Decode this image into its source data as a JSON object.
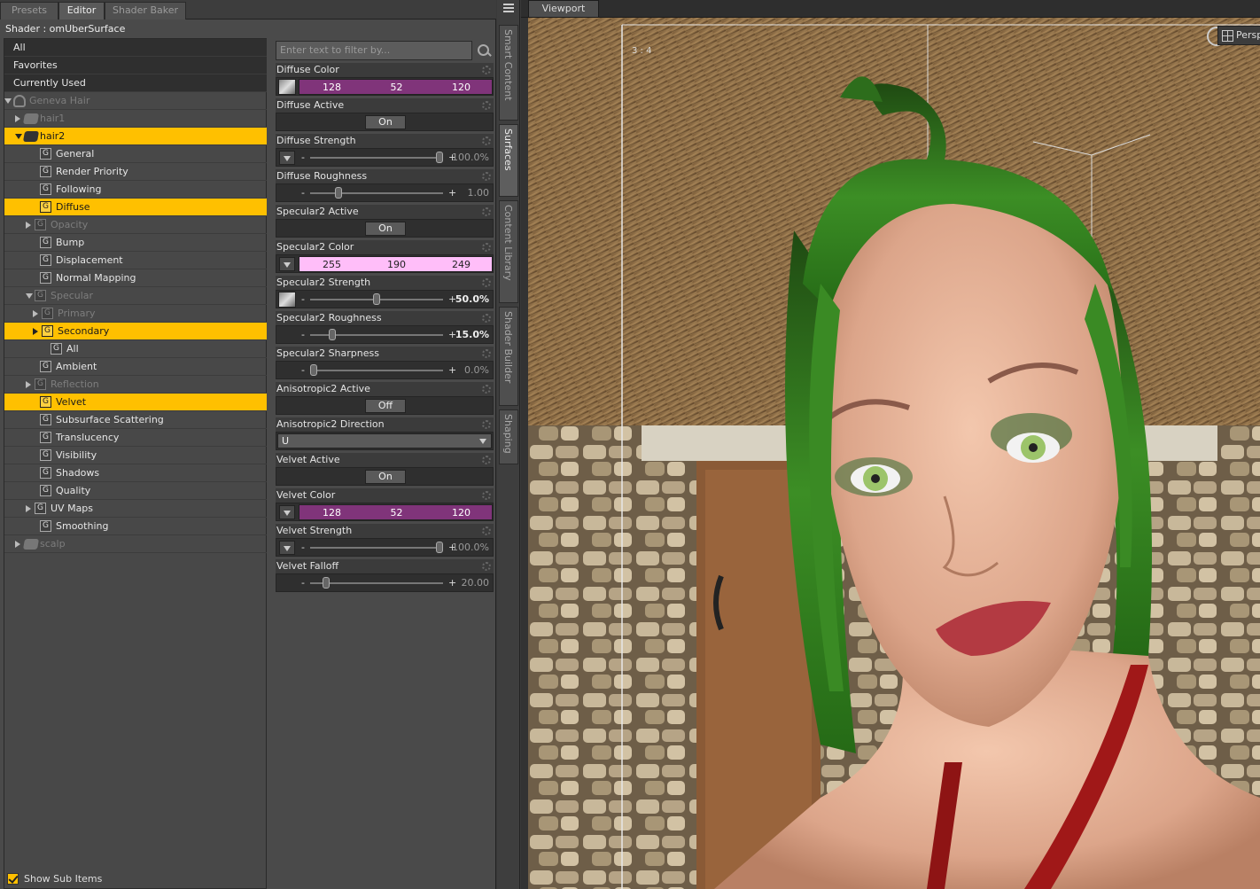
{
  "tabs": [
    "Presets",
    "Editor",
    "Shader Baker"
  ],
  "active_tab": "Editor",
  "shader_label": "Shader : omUberSurface",
  "tree": [
    {
      "label": "All",
      "kind": "cat"
    },
    {
      "label": "Favorites",
      "kind": "cat"
    },
    {
      "label": "Currently Used",
      "kind": "cat"
    },
    {
      "label": "Geneva Hair",
      "icon": "figure-icon",
      "expand": "down",
      "dim": true
    },
    {
      "label": "hair1",
      "icon": "object-icon",
      "expand": "right",
      "dim": true
    },
    {
      "label": "hair2",
      "icon": "object-icon",
      "expand": "down",
      "selected": true
    },
    {
      "label": "General",
      "icon": "group-icon"
    },
    {
      "label": "Render Priority",
      "icon": "group-icon"
    },
    {
      "label": "Following",
      "icon": "group-icon"
    },
    {
      "label": "Diffuse",
      "icon": "group-icon",
      "selected": true
    },
    {
      "label": "Opacity",
      "icon": "group-icon",
      "expand": "right",
      "dim": true
    },
    {
      "label": "Bump",
      "icon": "group-icon"
    },
    {
      "label": "Displacement",
      "icon": "group-icon"
    },
    {
      "label": "Normal Mapping",
      "icon": "group-icon"
    },
    {
      "label": "Specular",
      "icon": "group-icon",
      "expand": "down",
      "dim": true
    },
    {
      "label": "Primary",
      "icon": "group-icon",
      "expand": "right",
      "dim": true
    },
    {
      "label": "Secondary",
      "icon": "group-icon",
      "expand": "right",
      "selected": true
    },
    {
      "label": "All",
      "icon": "group-icon"
    },
    {
      "label": "Ambient",
      "icon": "group-icon"
    },
    {
      "label": "Reflection",
      "icon": "group-icon",
      "expand": "right",
      "dim": true
    },
    {
      "label": "Velvet",
      "icon": "group-icon",
      "selected": true
    },
    {
      "label": "Subsurface Scattering",
      "icon": "group-icon"
    },
    {
      "label": "Translucency",
      "icon": "group-icon"
    },
    {
      "label": "Visibility",
      "icon": "group-icon"
    },
    {
      "label": "Shadows",
      "icon": "group-icon"
    },
    {
      "label": "Quality",
      "icon": "group-icon"
    },
    {
      "label": "UV Maps",
      "icon": "group-icon",
      "expand": "right"
    },
    {
      "label": "Smoothing",
      "icon": "group-icon"
    },
    {
      "label": "scalp",
      "icon": "object-icon",
      "expand": "right",
      "dim": true
    }
  ],
  "group_glyph": "G",
  "show_sub_items": {
    "label": "Show Sub Items",
    "checked": true
  },
  "filter_placeholder": "Enter text to filter by...",
  "properties": [
    {
      "name": "Diffuse Color",
      "type": "color",
      "thumb": true,
      "rgb": [
        128,
        52,
        120
      ],
      "bg": "#80347a",
      "fg": "#ffffff"
    },
    {
      "name": "Diffuse Active",
      "type": "toggle",
      "value": "On"
    },
    {
      "name": "Diffuse Strength",
      "type": "slider",
      "menu": true,
      "fraction": 1.0,
      "value": "100.0%",
      "bold": false
    },
    {
      "name": "Diffuse Roughness",
      "type": "slider",
      "fraction": 0.2,
      "value": "1.00",
      "bold": false
    },
    {
      "name": "Specular2 Active",
      "type": "toggle",
      "value": "On"
    },
    {
      "name": "Specular2 Color",
      "type": "color",
      "thumb": false,
      "rgb": [
        255,
        190,
        249
      ],
      "bg": "#ffbef9",
      "fg": "#222222"
    },
    {
      "name": "Specular2 Strength",
      "type": "slider",
      "thumb": true,
      "fraction": 0.5,
      "value": "50.0%",
      "bold": true
    },
    {
      "name": "Specular2 Roughness",
      "type": "slider",
      "fraction": 0.15,
      "value": "15.0%",
      "bold": true
    },
    {
      "name": "Specular2 Sharpness",
      "type": "slider",
      "fraction": 0.0,
      "value": "0.0%",
      "bold": false
    },
    {
      "name": "Anisotropic2 Active",
      "type": "toggle",
      "value": "Off"
    },
    {
      "name": "Anisotropic2 Direction",
      "type": "dropdown",
      "value": "U"
    },
    {
      "name": "Velvet Active",
      "type": "toggle",
      "value": "On"
    },
    {
      "name": "Velvet Color",
      "type": "color",
      "thumb": false,
      "rgb": [
        128,
        52,
        120
      ],
      "bg": "#80347a",
      "fg": "#ffffff"
    },
    {
      "name": "Velvet Strength",
      "type": "slider",
      "menu": true,
      "fraction": 1.0,
      "value": "100.0%",
      "bold": false
    },
    {
      "name": "Velvet Falloff",
      "type": "slider",
      "fraction": 0.1,
      "value": "20.00",
      "bold": false
    }
  ],
  "side_tabs": [
    "Smart Content",
    "Surfaces",
    "Content Library",
    "Shader Builder",
    "Shaping"
  ],
  "active_side_tab": "Surfaces",
  "viewport": {
    "tab": "Viewport",
    "aspect": "3 : 4",
    "camera": "Persp"
  },
  "colors": {
    "selection": "#ffc000",
    "panel": "#4a4a4a",
    "hair": "#2f7a1e",
    "skin": "#e7b59b",
    "thatch": "#8a6a43"
  }
}
